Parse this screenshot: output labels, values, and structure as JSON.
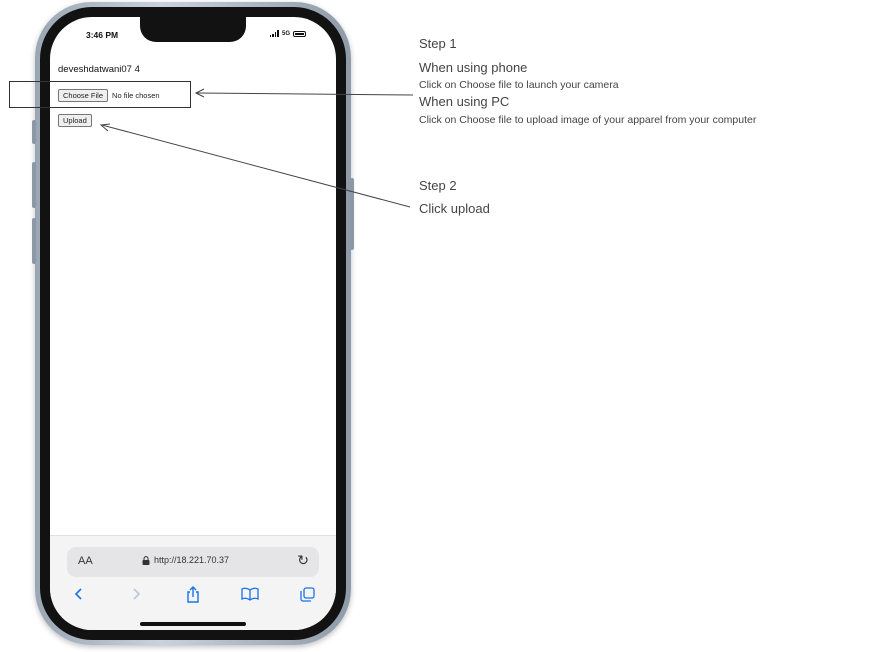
{
  "phone": {
    "status_time": "3:46 PM",
    "network": "5G",
    "username_line": "deveshdatwani07 4",
    "choose_file_label": "Choose File",
    "file_status": "No file chosen",
    "upload_label": "Upload",
    "address_bar": {
      "aa_label": "AA",
      "url": "http://18.221.70.37"
    },
    "toolbar_icons": [
      "back-icon",
      "forward-icon",
      "share-icon",
      "bookmarks-icon",
      "tabs-icon"
    ]
  },
  "instructions": {
    "step1_title": "Step 1",
    "phone_heading": "When using phone",
    "phone_text": "Click on Choose file to launch your camera",
    "pc_heading": "When using PC",
    "pc_text": "Click on Choose file to upload image of your apparel from your computer",
    "step2_title": "Step 2",
    "step2_text": "Click upload"
  },
  "colors": {
    "safari_blue": "#1a73e8",
    "frame": "#121212"
  }
}
